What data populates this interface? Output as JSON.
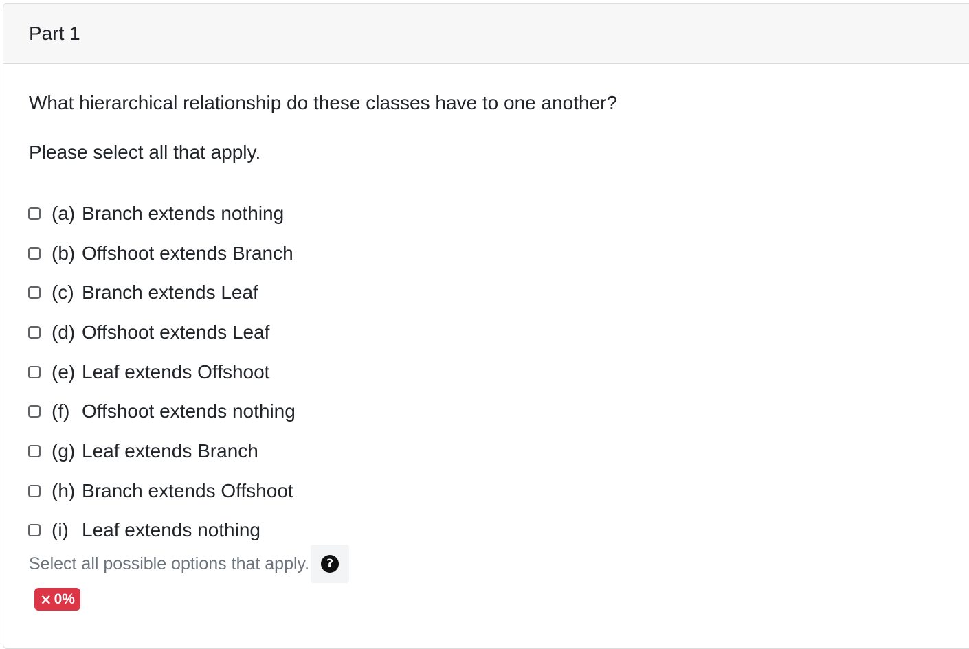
{
  "header": {
    "title": "Part 1"
  },
  "question": {
    "text": "What hierarchical relationship do these classes have to one another?",
    "instruction": "Please select all that apply."
  },
  "options": [
    {
      "key": "(a)",
      "label": "Branch extends nothing",
      "checked": false
    },
    {
      "key": "(b)",
      "label": "Offshoot extends Branch",
      "checked": false
    },
    {
      "key": "(c)",
      "label": "Branch extends Leaf",
      "checked": false
    },
    {
      "key": "(d)",
      "label": "Offshoot extends Leaf",
      "checked": false
    },
    {
      "key": "(e)",
      "label": "Leaf extends Offshoot",
      "checked": false
    },
    {
      "key": "(f)",
      "label": "Offshoot extends nothing",
      "checked": false
    },
    {
      "key": "(g)",
      "label": "Leaf extends Branch",
      "checked": false
    },
    {
      "key": "(h)",
      "label": "Branch extends Offshoot",
      "checked": false
    },
    {
      "key": "(i)",
      "label": "Leaf extends nothing",
      "checked": false
    }
  ],
  "hint": {
    "text": "Select all possible options that apply.",
    "help_icon": "question-circle-icon",
    "help_glyph": "?"
  },
  "score": {
    "icon": "x-icon",
    "glyph": "×",
    "value": "0%",
    "color": "#dc3545"
  }
}
